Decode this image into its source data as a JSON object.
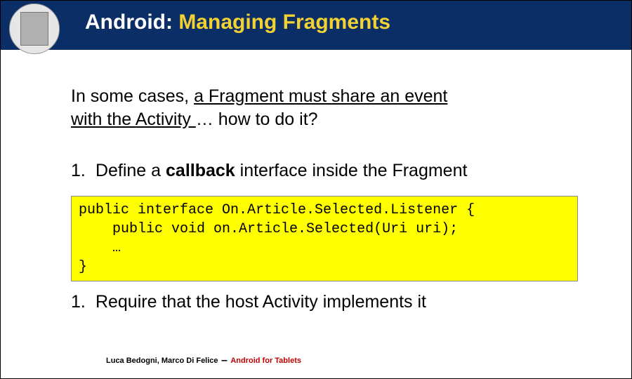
{
  "header": {
    "title_part1": "Android: ",
    "title_part2": "Managing Fragments"
  },
  "intro": {
    "plain1": "In some cases, ",
    "underline1": "a Fragment must share an event",
    "underline2": "with the Activity ",
    "plain2": "… how to do it?"
  },
  "points": {
    "p1_num": "1.",
    "p1_pre": " Define a ",
    "p1_bold": "callback",
    "p1_post": " interface inside the Fragment",
    "p2_num": "1.",
    "p2_text": " Require that the host Activity implements it"
  },
  "code": {
    "line1": "public interface On.Article.Selected.Listener {",
    "line2": "    public void on.Article.Selected(Uri uri);",
    "line3": "    …",
    "line4": "}"
  },
  "footer": {
    "authors": "Luca Bedogni, Marco Di Felice",
    "dash": " – ",
    "course": "Android for Tablets"
  }
}
